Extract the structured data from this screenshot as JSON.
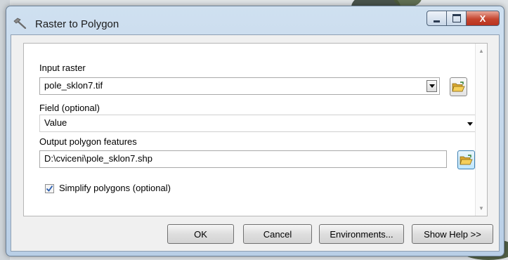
{
  "window": {
    "title": "Raster to Polygon",
    "minimize_glyph": "",
    "maximize_glyph": "",
    "close_glyph": "X"
  },
  "form": {
    "input_raster": {
      "label": "Input raster",
      "value": "pole_sklon7.tif"
    },
    "field": {
      "label": "Field (optional)",
      "value": "Value"
    },
    "output": {
      "label": "Output polygon features",
      "value": "D:\\cviceni\\pole_sklon7.shp"
    },
    "simplify": {
      "label": "Simplify polygons (optional)",
      "checked": true
    }
  },
  "buttons": {
    "ok": "OK",
    "cancel": "Cancel",
    "environments": "Environments...",
    "show_help": "Show Help >>"
  },
  "icons": {
    "title": "hammer-icon",
    "browse": "open-folder-icon",
    "check": "checkmark-icon"
  },
  "colors": {
    "title_bar": "#c4d8ec",
    "close_button": "#c5462f",
    "folder": "#f0c64a",
    "checkmark": "#2a5db0"
  }
}
